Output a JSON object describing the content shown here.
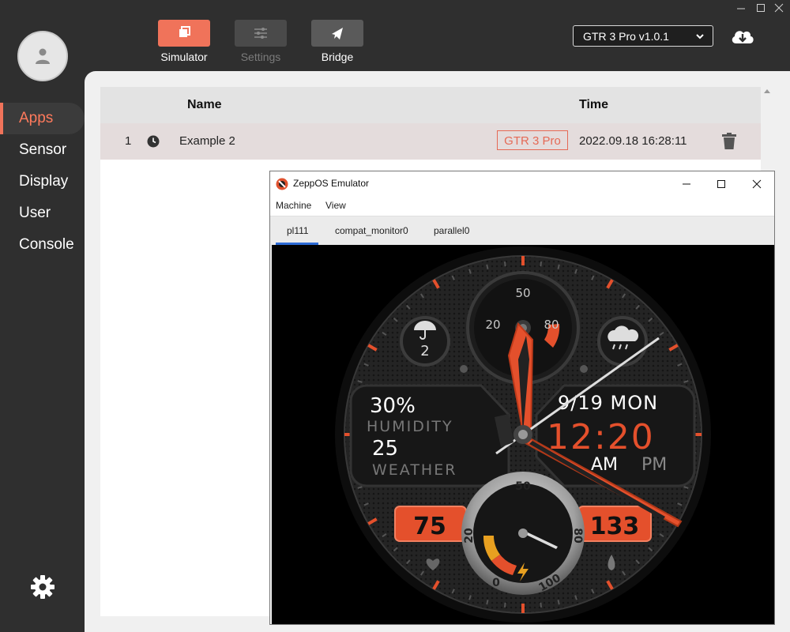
{
  "sidebar": {
    "items": [
      {
        "label": "Apps",
        "active": true
      },
      {
        "label": "Sensor",
        "active": false
      },
      {
        "label": "Display",
        "active": false
      },
      {
        "label": "User",
        "active": false
      },
      {
        "label": "Console",
        "active": false
      }
    ],
    "avatar_icon": "user-icon",
    "settings_icon": "gear-icon"
  },
  "toolbar": {
    "simulator": "Simulator",
    "settings": "Settings",
    "bridge": "Bridge",
    "device_select": "GTR 3 Pro v1.0.1",
    "accent": "#f0735a"
  },
  "table": {
    "columns": [
      "Name",
      "Time"
    ],
    "rows": [
      {
        "index": "1",
        "name": "Example 2",
        "device": "GTR 3 Pro",
        "time": "2022.09.18 16:28:11"
      }
    ]
  },
  "emulator": {
    "title": "ZeppOS Emulator",
    "menu": [
      "Machine",
      "View"
    ],
    "tabs": [
      "pl111",
      "compat_monitor0",
      "parallel0"
    ],
    "active_tab": "pl111",
    "watch": {
      "humidity": "30%",
      "humidity_label": "HUMIDITY",
      "weather_value": "25",
      "weather_label": "WEATHER",
      "date": "9/19 MON",
      "time": "12:20",
      "am": "AM",
      "pm": "PM",
      "left_box": "75",
      "right_box": "133",
      "uv_value": "2",
      "top_dial": {
        "t50": "50",
        "t20": "20",
        "t80": "80"
      },
      "bottom_dial": {
        "t50": "50",
        "t20": "20",
        "t80": "80",
        "t0": "0",
        "t100": "100"
      }
    }
  }
}
